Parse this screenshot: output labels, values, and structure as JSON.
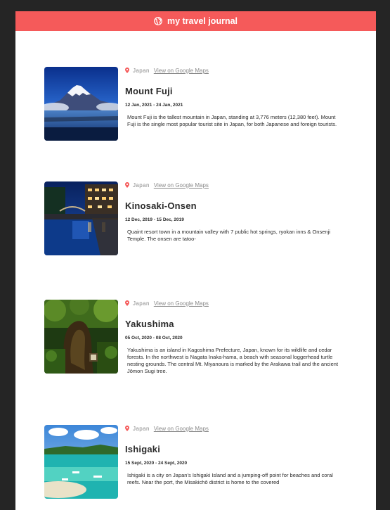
{
  "header": {
    "title": "my travel journal",
    "icon": "globe-icon"
  },
  "accent_color": "#f55a5a",
  "entries": [
    {
      "country": "Japan",
      "maps_label": "View on Google Maps",
      "title": "Mount Fuji",
      "dates": "12 Jan, 2021 - 24 Jan, 2021",
      "description": "Mount Fuji is the tallest mountain in Japan, standing at 3,776 meters (12,380 feet). Mount Fuji is the single most popular tourist site in Japan, for both Japanese and foreign tourists."
    },
    {
      "country": "Japan",
      "maps_label": "View on Google Maps",
      "title": "Kinosaki-Onsen",
      "dates": "12 Dec, 2019 - 15 Dec, 2019",
      "description": "Quaint resort town in a mountain valley with 7 public hot springs, ryokan inns & Onsenji Temple. The onsen are tatoo-"
    },
    {
      "country": "Japan",
      "maps_label": "View on Google Maps",
      "title": "Yakushima",
      "dates": "05 Oct, 2020 - 08 Oct, 2020",
      "description": "Yakushima is an island in Kagoshima Prefecture, Japan, known for its wildlife and cedar forests. In the northwest is Nagata Inaka-hama, a beach with seasonal loggerhead turtle nesting grounds. The central Mt. Miyanoura is marked by the Arakawa trail and the ancient Jōmon Sugi tree."
    },
    {
      "country": "Japan",
      "maps_label": "View on Google Maps",
      "title": "Ishigaki",
      "dates": "15 Sept, 2020 - 24 Sept, 2020",
      "description": "Ishigaki is a city on Japan’s Ishigaki Island and a jumping-off point for beaches and coral reefs. Near the port, the Misakichō district is home to the covered"
    }
  ]
}
